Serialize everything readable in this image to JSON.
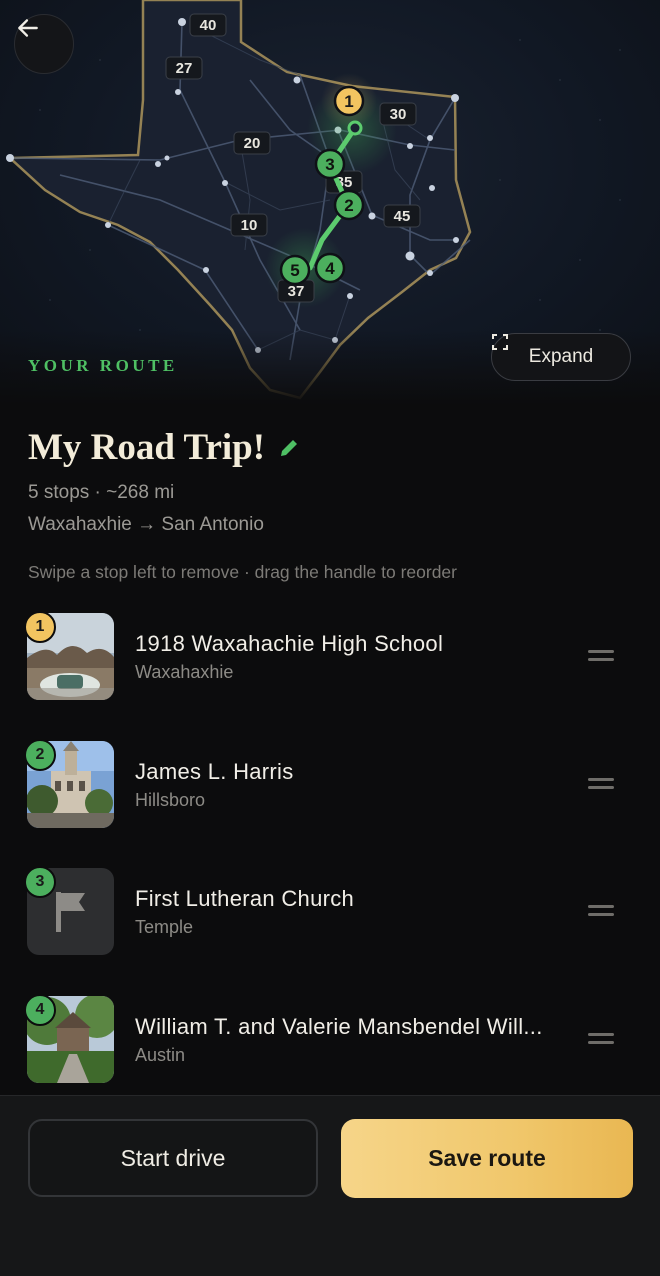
{
  "map": {
    "highway_labels": [
      "40",
      "27",
      "20",
      "30",
      "10",
      "45",
      "35",
      "37"
    ],
    "markers": [
      "1",
      "3",
      "2",
      "5",
      "4"
    ],
    "route_color": "#4fc064",
    "marker_start_color": "#f2c460",
    "marker_color": "#4caf5e"
  },
  "header": {
    "back_icon": "arrow-left-icon",
    "expand_label": "Expand",
    "expand_icon": "expand-icon",
    "section_label": "YOUR ROUTE"
  },
  "trip": {
    "title": "My Road Trip!",
    "edit_icon": "pencil-icon",
    "summary": "5 stops · ~268 mi",
    "endpoints": "Waxahaxhie → San Antonio",
    "hint": "Swipe a stop left to remove · drag the handle to reorder"
  },
  "stops": [
    {
      "num": "1",
      "name": "1918 Waxahachie High School",
      "city": "Waxahaxhie"
    },
    {
      "num": "2",
      "name": "James L. Harris",
      "city": "Hillsboro"
    },
    {
      "num": "3",
      "name": "First Lutheran Church",
      "city": "Temple"
    },
    {
      "num": "4",
      "name": "William T. and Valerie Mansbendel Will...",
      "city": "Austin"
    }
  ],
  "actions": {
    "start_label": "Start drive",
    "save_label": "Save route"
  },
  "colors": {
    "accent_gold": "#f0c76b",
    "accent_green": "#4fc064",
    "background": "#0c0c0d"
  }
}
